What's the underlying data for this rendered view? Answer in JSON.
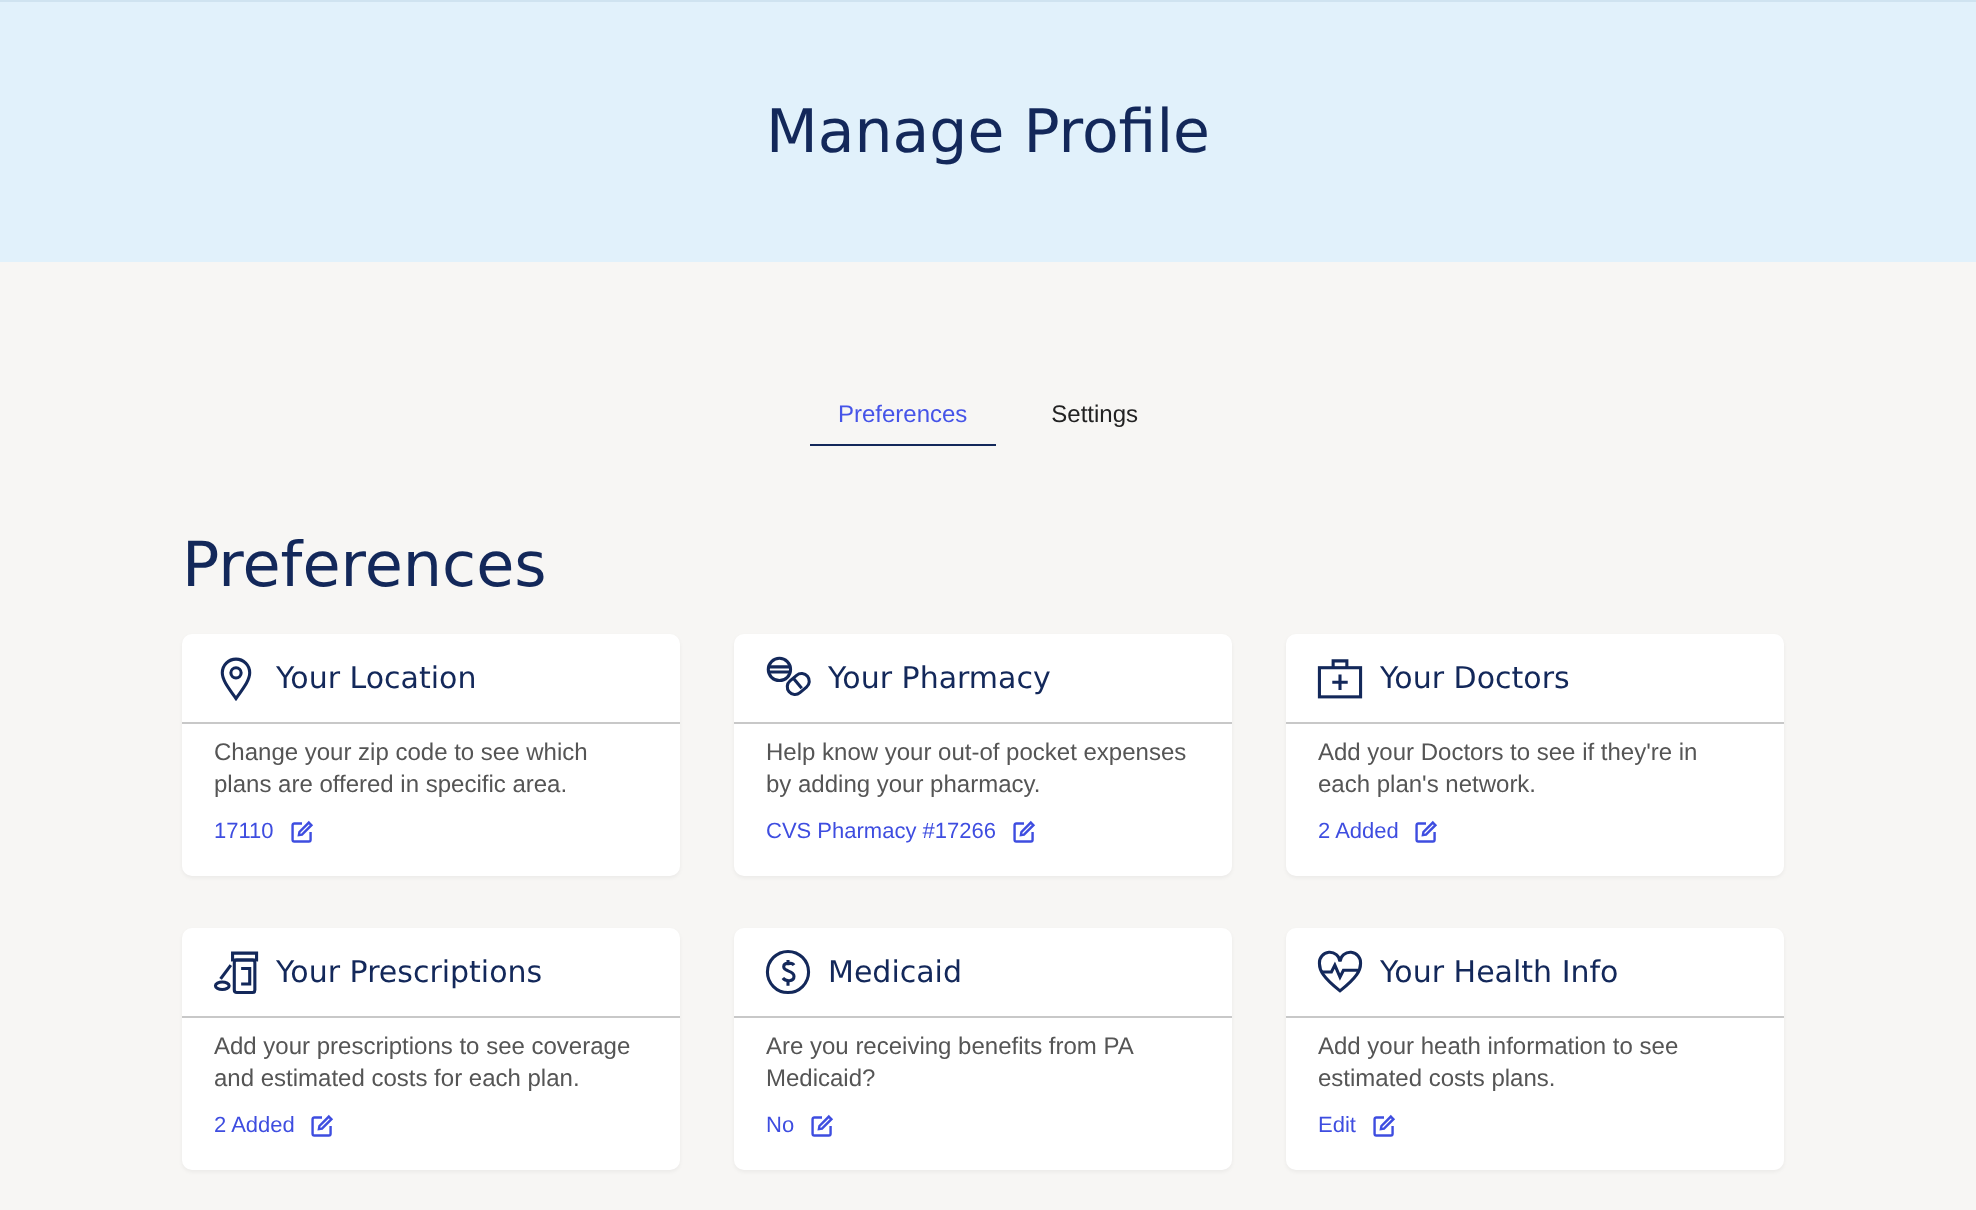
{
  "header": {
    "title": "Manage Profile"
  },
  "tabs": [
    {
      "label": "Preferences",
      "selected": true
    },
    {
      "label": "Settings",
      "selected": false
    }
  ],
  "section_title": "Preferences",
  "cards": [
    {
      "kind": "location",
      "title": "Your Location",
      "description": "Change your zip code to see which plans are offered in specific area.",
      "value": "17110"
    },
    {
      "kind": "pharmacy",
      "title": "Your Pharmacy",
      "description": "Help know your out-of pocket expenses by adding your pharmacy.",
      "value": "CVS Pharmacy #17266"
    },
    {
      "kind": "doctors",
      "title": "Your Doctors",
      "description": "Add your Doctors to see if they're in each plan's network.",
      "value": "2 Added"
    },
    {
      "kind": "prescriptions",
      "title": "Your Prescriptions",
      "description": "Add your prescriptions to see coverage and estimated costs for each plan.",
      "value": "2 Added"
    },
    {
      "kind": "medicaid",
      "title": "Medicaid",
      "description": "Are you receiving benefits from PA Medicaid?",
      "value": "No"
    },
    {
      "kind": "health",
      "title": "Your Health Info",
      "description": "Add your heath information to see estimated costs plans.",
      "value": "Edit"
    }
  ]
}
